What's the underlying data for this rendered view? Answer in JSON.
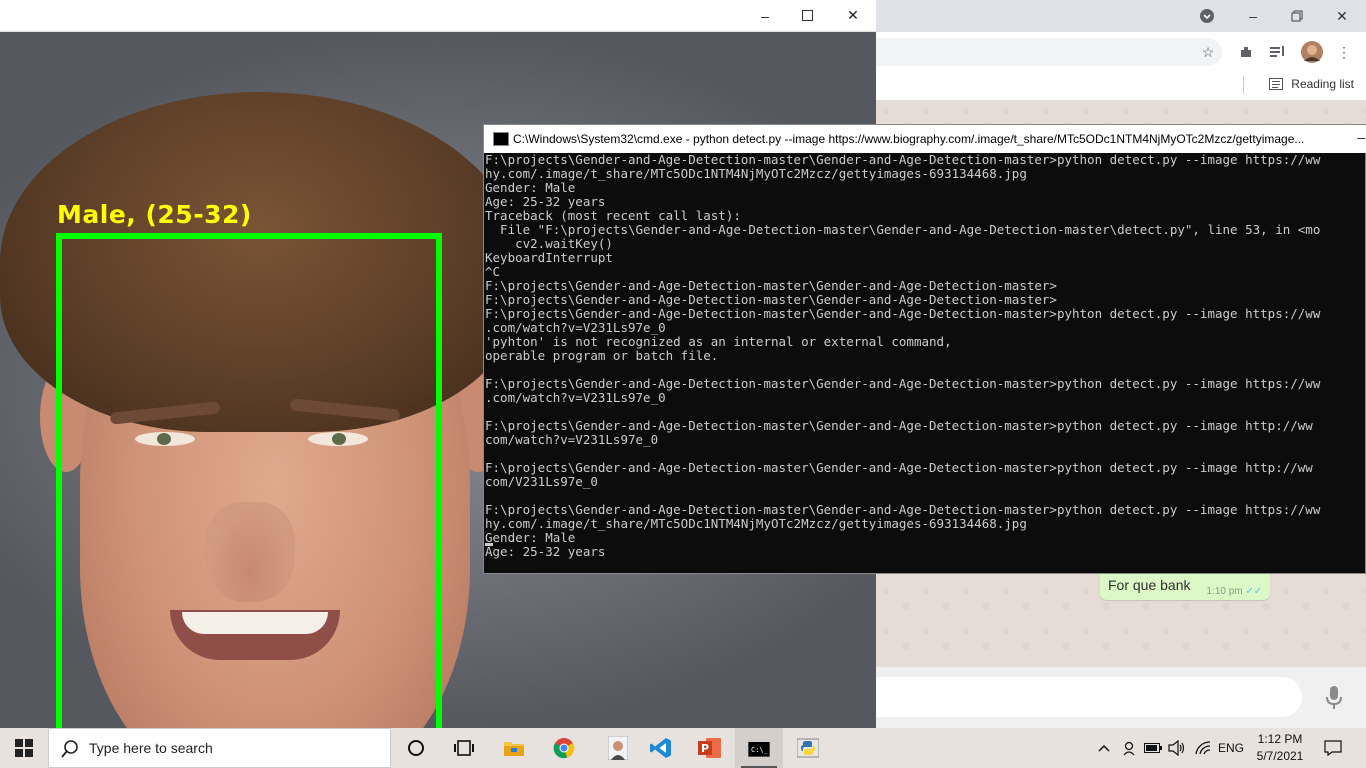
{
  "chrome": {
    "reading_list_label": "Reading list",
    "chat_bubble": {
      "text": "For que bank",
      "time": "1:10 pm",
      "ticks": "✓✓"
    }
  },
  "image_window": {
    "detection_label": "Male, (25-32)",
    "box_color": "#00ff00",
    "label_color": "#ffff00"
  },
  "cmd": {
    "title": "C:\\Windows\\System32\\cmd.exe - python  detect.py --image https://www.biography.com/.image/t_share/MTc5ODc1NTM4NjMyOTc2Mzcz/gettyimage...",
    "lines": [
      "F:\\projects\\Gender-and-Age-Detection-master\\Gender-and-Age-Detection-master>python detect.py --image https://ww",
      "hy.com/.image/t_share/MTc5ODc1NTM4NjMyOTc2Mzcz/gettyimages-693134468.jpg",
      "Gender: Male",
      "Age: 25-32 years",
      "Traceback (most recent call last):",
      "  File \"F:\\projects\\Gender-and-Age-Detection-master\\Gender-and-Age-Detection-master\\detect.py\", line 53, in <mo",
      "    cv2.waitKey()",
      "KeyboardInterrupt",
      "^C",
      "F:\\projects\\Gender-and-Age-Detection-master\\Gender-and-Age-Detection-master>",
      "F:\\projects\\Gender-and-Age-Detection-master\\Gender-and-Age-Detection-master>",
      "F:\\projects\\Gender-and-Age-Detection-master\\Gender-and-Age-Detection-master>pyhton detect.py --image https://ww",
      ".com/watch?v=V231Ls97e_0",
      "'pyhton' is not recognized as an internal or external command,",
      "operable program or batch file.",
      "",
      "F:\\projects\\Gender-and-Age-Detection-master\\Gender-and-Age-Detection-master>python detect.py --image https://ww",
      ".com/watch?v=V231Ls97e_0",
      "",
      "F:\\projects\\Gender-and-Age-Detection-master\\Gender-and-Age-Detection-master>python detect.py --image http://ww",
      "com/watch?v=V231Ls97e_0",
      "",
      "F:\\projects\\Gender-and-Age-Detection-master\\Gender-and-Age-Detection-master>python detect.py --image http://ww",
      "com/V231Ls97e_0",
      "",
      "F:\\projects\\Gender-and-Age-Detection-master\\Gender-and-Age-Detection-master>python detect.py --image https://ww",
      "hy.com/.image/t_share/MTc5ODc1NTM4NjMyOTc2Mzcz/gettyimages-693134468.jpg",
      "Gender: Male",
      "Age: 25-32 years"
    ]
  },
  "taskbar": {
    "search_placeholder": "Type here to search",
    "apps": [
      {
        "name": "task-view",
        "icon": "circle"
      },
      {
        "name": "widgets",
        "icon": "task-view"
      },
      {
        "name": "file-explorer",
        "icon": "folder"
      },
      {
        "name": "chrome",
        "icon": "chrome"
      },
      {
        "name": "photo-app",
        "icon": "photo"
      },
      {
        "name": "vscode",
        "icon": "vscode"
      },
      {
        "name": "powerpoint",
        "icon": "powerpoint"
      },
      {
        "name": "cmd",
        "icon": "terminal"
      },
      {
        "name": "python",
        "icon": "python"
      }
    ],
    "language": "ENG",
    "time": "1:12 PM",
    "date": "5/7/2021"
  }
}
